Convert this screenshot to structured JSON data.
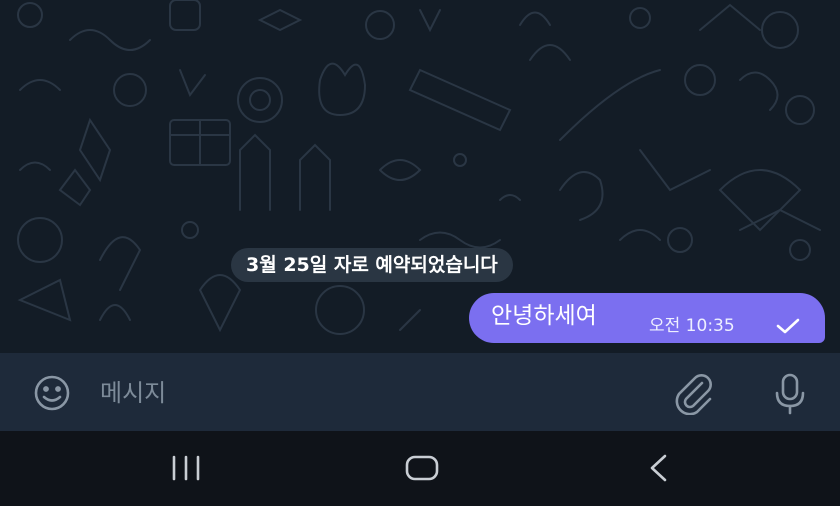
{
  "chat": {
    "date_separator": "3월 25일 자로 예약되었습니다",
    "messages": [
      {
        "text": "안녕하세여",
        "time": "오전 10:35",
        "status_icon": "check-icon",
        "direction": "outgoing"
      }
    ]
  },
  "composer": {
    "placeholder": "메시지",
    "value": "",
    "left_icon": "emoji-icon",
    "right_icons": [
      "paperclip-icon",
      "microphone-icon"
    ]
  },
  "system_nav": {
    "buttons": [
      "recent-apps-icon",
      "home-icon",
      "back-icon"
    ]
  },
  "colors": {
    "chat_background": "#131c26",
    "bubble": "#7b6ff0",
    "input_bar": "#1e2a3a",
    "nav_bar": "#0f1319"
  }
}
